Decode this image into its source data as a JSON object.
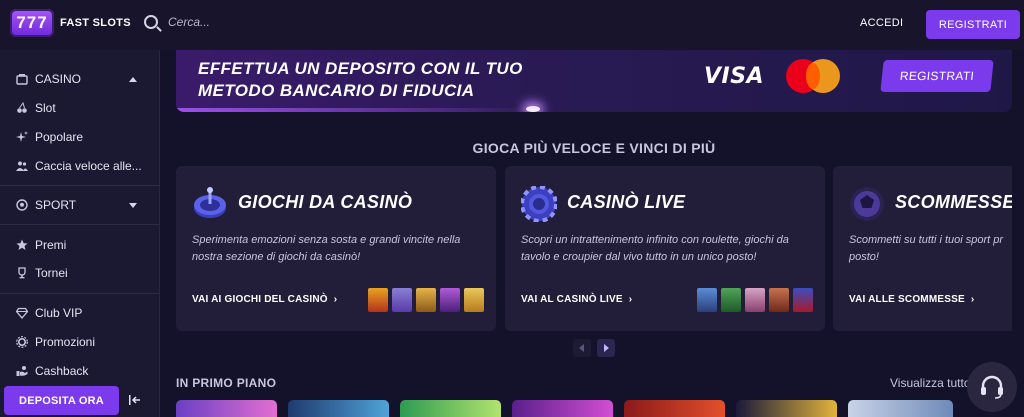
{
  "header": {
    "logo_badge": "777",
    "logo_text": "FAST SLOTS",
    "search_placeholder": "Cerca...",
    "login_label": "ACCEDI",
    "register_label": "REGISTRATI"
  },
  "sidebar": {
    "casino_label": "CASINO",
    "slot_label": "Slot",
    "popolare_label": "Popolare",
    "caccia_label": "Caccia veloce alle...",
    "sport_label": "SPORT",
    "premi_label": "Premi",
    "tornei_label": "Tornei",
    "club_vip_label": "Club VIP",
    "promozioni_label": "Promozioni",
    "cashback_label": "Cashback",
    "deposit_label": "DEPOSITA ORA"
  },
  "banner": {
    "title_line1": "EFFETTUA UN DEPOSITO CON IL TUO",
    "title_line2": "METODO BANCARIO DI FIDUCIA",
    "visa_text": "VISA",
    "register_label": "REGISTRATI"
  },
  "section": {
    "heading": "GIOCA PIÙ VELOCE E VINCI DI PIÙ"
  },
  "cards": [
    {
      "title": "GIOCHI DA CASINÒ",
      "description": "Sperimenta emozioni senza sosta e grandi vincite nella nostra sezione di giochi da casinò!",
      "link": "VAI AI GIOCHI DEL CASINÒ"
    },
    {
      "title": "CASINÒ LIVE",
      "description": "Scopri un intrattenimento infinito con roulette, giochi da tavolo e croupier dal vivo tutto in un unico posto!",
      "link": "VAI AL CASINÒ LIVE"
    },
    {
      "title": "SCOMMESSE S",
      "description": "Scommetti su tutti i tuoi sport pr posto!",
      "link": "VAI ALLE SCOMMESSE"
    }
  ],
  "featured": {
    "title": "IN PRIMO PIANO",
    "view_all": "Visualizza tutto"
  },
  "colors": {
    "accent": "#7c3aed",
    "background": "#14112a",
    "card": "#221e3a",
    "sidebar": "#1b1831"
  }
}
